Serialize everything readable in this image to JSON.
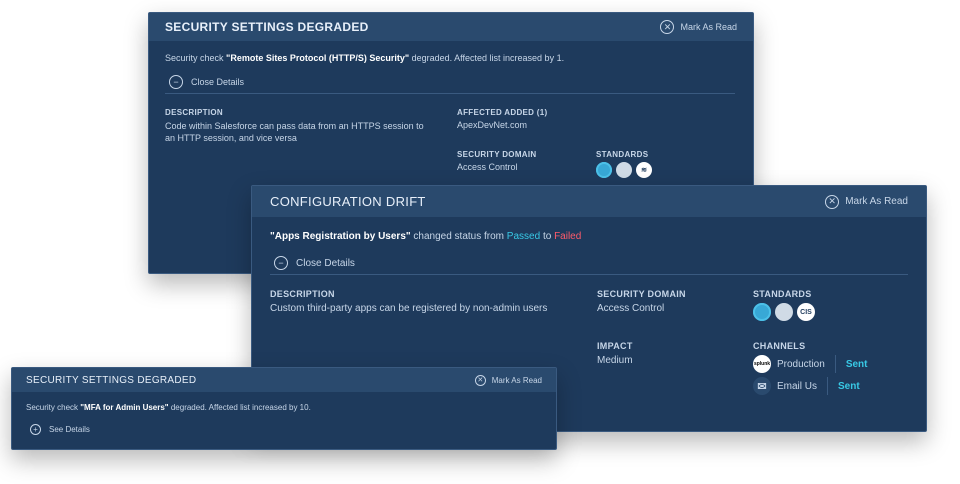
{
  "card1": {
    "title": "SECURITY SETTINGS DEGRADED",
    "mark_label": "Mark As Read",
    "msg_prefix": "Security check",
    "msg_quote": "\"Remote Sites Protocol (HTTP/S) Security\"",
    "msg_suffix": "degraded. Affected list increased by 1.",
    "toggle_label": "Close Details",
    "desc_label": "DESCRIPTION",
    "desc_text": "Code within Salesforce can pass data from an HTTPS session to an HTTP session, and vice versa",
    "affected_label": "AFFECTED ADDED (1)",
    "affected_value": "ApexDevNet.com",
    "domain_label": "SECURITY DOMAIN",
    "domain_value": "Access Control",
    "standards_label": "STANDARDS"
  },
  "card2": {
    "title": "CONFIGURATION DRIFT",
    "mark_label": "Mark As Read",
    "msg_quote": "\"Apps Registration by Users\"",
    "msg_mid": "changed status from",
    "status_from": "Passed",
    "msg_to": "to",
    "status_to": "Failed",
    "toggle_label": "Close Details",
    "desc_label": "DESCRIPTION",
    "desc_text": "Custom third-party apps can be registered by non-admin users",
    "domain_label": "SECURITY DOMAIN",
    "domain_value": "Access Control",
    "standards_label": "STANDARDS",
    "impact_label": "IMPACT",
    "impact_value": "Medium",
    "channels_label": "CHANNELS",
    "channels": [
      {
        "icon": "splunk",
        "name": "Production",
        "status": "Sent"
      },
      {
        "icon": "email",
        "name": "Email Us",
        "status": "Sent"
      }
    ],
    "cis_badge": "CIS"
  },
  "card3": {
    "title": "SECURITY SETTINGS DEGRADED",
    "mark_label": "Mark As Read",
    "msg_prefix": "Security check",
    "msg_quote": "\"MFA for Admin Users\"",
    "msg_suffix": "degraded. Affected list increased by 10.",
    "toggle_label": "See Details"
  },
  "colors": {
    "card_bg": "#1e3a5c",
    "header_bg": "#2a4a6e",
    "accent_cyan": "#38c9e6",
    "failed_red": "#ff5b6b"
  }
}
